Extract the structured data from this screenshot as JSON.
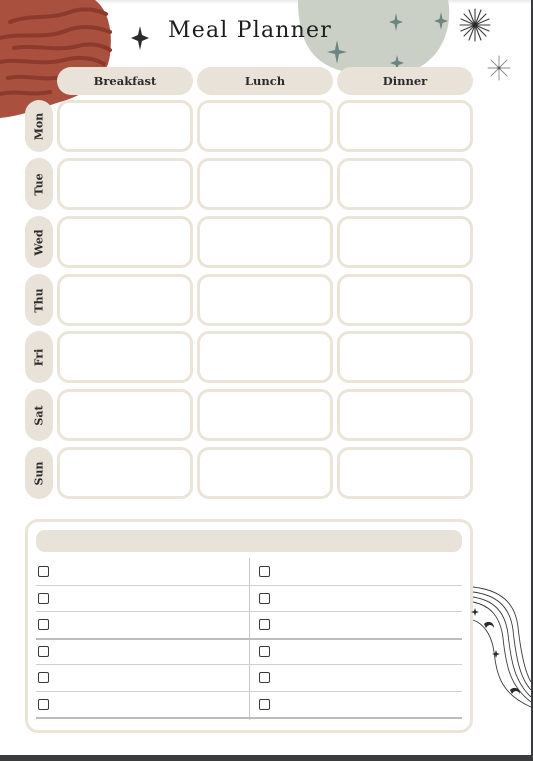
{
  "title": "Meal Planner",
  "meals": [
    "Breakfast",
    "Lunch",
    "Dinner"
  ],
  "days": [
    "Mon",
    "Tue",
    "Wed",
    "Thu",
    "Fri",
    "Sat",
    "Sun"
  ],
  "grocery_list": {
    "heading": "",
    "columns": 2,
    "rows_per_column": 6,
    "items_checked": [
      [
        false,
        false
      ],
      [
        false,
        false
      ],
      [
        false,
        false
      ],
      [
        false,
        false
      ],
      [
        false,
        false
      ],
      [
        false,
        false
      ]
    ]
  },
  "colors": {
    "accent_tan": "#e8e2d8",
    "cell_border": "#ebe4d9",
    "blob_terracotta": "#a9503f",
    "blob_sage": "#cbd0c7",
    "sparkle_teal": "#6b8580",
    "ink": "#1d1d1d"
  },
  "decorations": [
    "terracotta-wave-blob",
    "sage-blob-with-sparkles",
    "starburst",
    "wavy-lines-with-moons"
  ]
}
